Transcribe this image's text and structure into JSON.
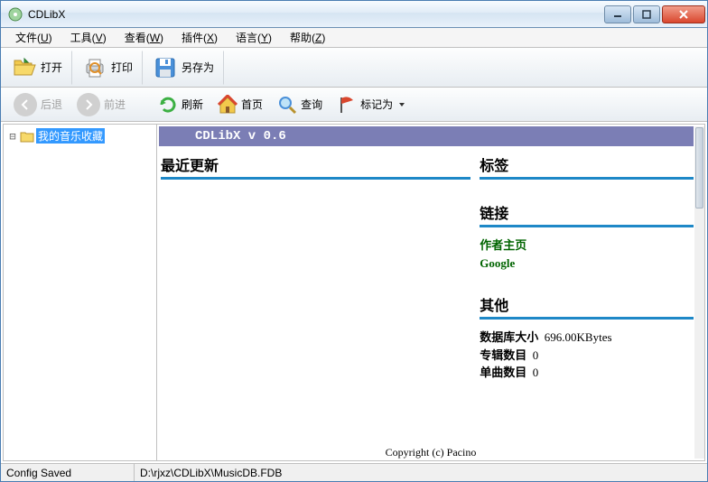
{
  "title": "CDLibX",
  "menu": {
    "file": "文件(<u>U</u>)",
    "tools": "工具(<u>V</u>)",
    "view": "查看(<u>W</u>)",
    "plugins": "插件(<u>X</u>)",
    "language": "语言(<u>Y</u>)",
    "help": "帮助(<u>Z</u>)"
  },
  "toolbar": {
    "open": "打开",
    "print": "打印",
    "saveas": "另存为"
  },
  "nav": {
    "back": "后退",
    "forward": "前进",
    "refresh": "刷新",
    "home": "首页",
    "search": "查询",
    "mark": "标记为"
  },
  "tree": {
    "root": "我的音乐收藏"
  },
  "banner": "CDLibX v 0.6",
  "sections": {
    "recent": "最近更新",
    "tags": "标签",
    "links": "链接",
    "other": "其他"
  },
  "links": {
    "author_home": "作者主页",
    "google": "Google"
  },
  "stats": {
    "db_size_label": "数据库大小",
    "db_size_value": "696.00KBytes",
    "albums_label": "专辑数目",
    "albums_value": "0",
    "tracks_label": "单曲数目",
    "tracks_value": "0"
  },
  "copyright": "Copyright (c) Pacino",
  "status": {
    "left": "Config Saved",
    "path": "D:\\rjxz\\CDLibX\\MusicDB.FDB"
  }
}
